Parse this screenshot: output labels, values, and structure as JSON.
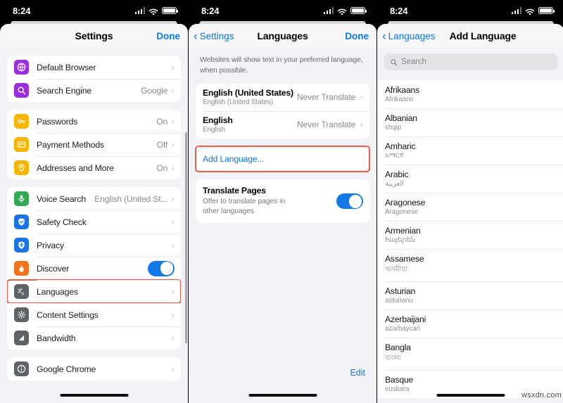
{
  "status": {
    "time": "8:24"
  },
  "panel1": {
    "nav": {
      "title": "Settings",
      "right": "Done"
    },
    "groups": [
      {
        "rows": [
          {
            "label": "Default Browser",
            "value": "",
            "icon": "globe-icon",
            "color": "#9b2fe0",
            "accessory": "chevron"
          },
          {
            "label": "Search Engine",
            "value": "Google",
            "icon": "search-icon",
            "color": "#9b2fe0",
            "accessory": "chevron"
          }
        ]
      },
      {
        "rows": [
          {
            "label": "Passwords",
            "value": "On",
            "icon": "key-icon",
            "color": "#f7b500",
            "accessory": "chevron"
          },
          {
            "label": "Payment Methods",
            "value": "Off",
            "icon": "credit-card-icon",
            "color": "#f7b500",
            "accessory": "chevron"
          },
          {
            "label": "Addresses and More",
            "value": "On",
            "icon": "location-pin-icon",
            "color": "#f7b500",
            "accessory": "chevron"
          }
        ]
      },
      {
        "rows": [
          {
            "label": "Voice Search",
            "value": "English (United St...",
            "icon": "microphone-icon",
            "color": "#34a853",
            "accessory": "chevron"
          },
          {
            "label": "Safety Check",
            "value": "",
            "icon": "shield-check-icon",
            "color": "#1a73e8",
            "accessory": "chevron"
          },
          {
            "label": "Privacy",
            "value": "",
            "icon": "shield-icon",
            "color": "#1a73e8",
            "accessory": "chevron"
          },
          {
            "label": "Discover",
            "value": "",
            "icon": "flame-icon",
            "color": "#f2711c",
            "accessory": "toggle",
            "toggle_on": true
          },
          {
            "label": "Languages",
            "value": "",
            "icon": "translate-icon",
            "color": "#5f6368",
            "accessory": "chevron",
            "highlighted": true
          },
          {
            "label": "Content Settings",
            "value": "",
            "icon": "gear-icon",
            "color": "#5f6368",
            "accessory": "chevron"
          },
          {
            "label": "Bandwidth",
            "value": "",
            "icon": "bandwidth-icon",
            "color": "#5f6368",
            "accessory": "chevron"
          }
        ]
      },
      {
        "rows": [
          {
            "label": "Google Chrome",
            "value": "",
            "icon": "info-icon",
            "color": "#5f6368",
            "accessory": "chevron"
          }
        ]
      }
    ]
  },
  "panel2": {
    "nav": {
      "back": "Settings",
      "title": "Languages",
      "right": "Done"
    },
    "description": "Websites will show text in your preferred language, when possible.",
    "languages": [
      {
        "name": "English (United States)",
        "native": "English (United States)",
        "state": "Never Translate"
      },
      {
        "name": "English",
        "native": "English",
        "state": "Never Translate"
      }
    ],
    "add_language_label": "Add Language...",
    "translate_pages": {
      "title": "Translate Pages",
      "subtitle": "Offer to translate pages in other languages",
      "toggle_on": true
    },
    "edit_label": "Edit"
  },
  "panel3": {
    "nav": {
      "back": "Languages",
      "title": "Add Language"
    },
    "search_placeholder": "Search",
    "languages": [
      {
        "name": "Afrikaans",
        "native": "Afrikaans"
      },
      {
        "name": "Albanian",
        "native": "shqip"
      },
      {
        "name": "Amharic",
        "native": "አማርኛ"
      },
      {
        "name": "Arabic",
        "native": "العربية"
      },
      {
        "name": "Aragonese",
        "native": "Aragonese"
      },
      {
        "name": "Armenian",
        "native": "հայերեն"
      },
      {
        "name": "Assamese",
        "native": "অসমীয়া"
      },
      {
        "name": "Asturian",
        "native": "asturianu"
      },
      {
        "name": "Azerbaijani",
        "native": "azərbaycan"
      },
      {
        "name": "Bangla",
        "native": "বাংলা"
      },
      {
        "name": "Basque",
        "native": "euskara"
      }
    ]
  },
  "watermark": "wsxdn.com",
  "colors": {
    "accent": "#0b78f0",
    "highlight": "#e8604c",
    "toggle_on": "#1479e8"
  }
}
